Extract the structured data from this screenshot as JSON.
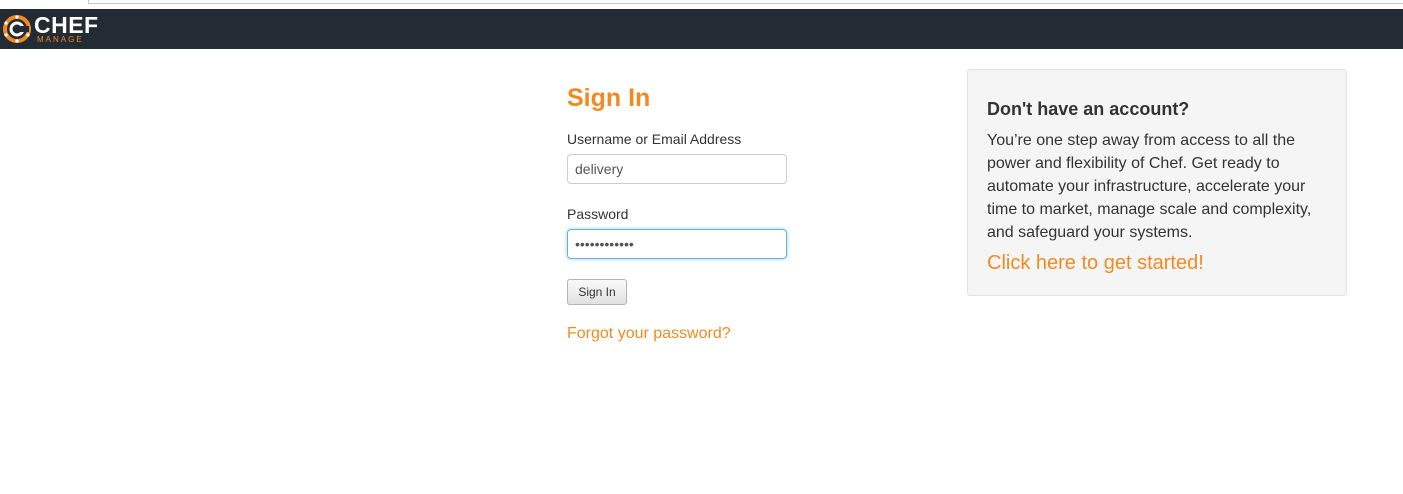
{
  "brand": {
    "name": "CHEF",
    "subtitle": "MANAGE",
    "accent_color": "#f18b21",
    "navbar_color": "#232c35",
    "logo_icon": "chef-logo-icon"
  },
  "signin": {
    "title": "Sign In",
    "username_label": "Username or Email Address",
    "username_value": "delivery",
    "password_label": "Password",
    "password_value": "••••••••••••",
    "submit_label": "Sign In",
    "forgot_label": "Forgot your password?"
  },
  "signup": {
    "heading": "Don't have an account?",
    "body": "You’re one step away from access to all the power and flexibility of Chef. Get ready to automate your infrastructure, accelerate your time to market, manage scale and complexity, and safeguard your systems.",
    "link_label": "Click here to get started!"
  }
}
